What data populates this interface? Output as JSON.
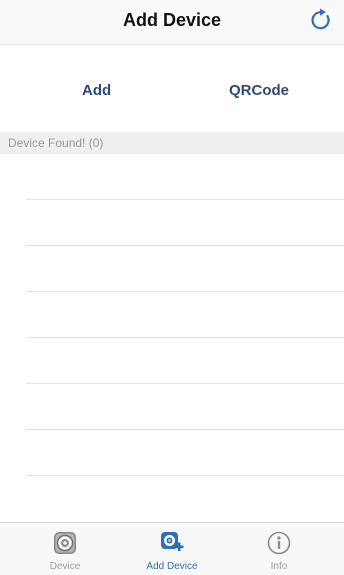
{
  "navbar": {
    "title": "Add Device",
    "refresh_icon": "refresh-icon"
  },
  "actions": {
    "add_label": "Add",
    "qrcode_label": "QRCode"
  },
  "device_list": {
    "header": "Device Found! (0)",
    "rows": [
      "",
      "",
      "",
      "",
      "",
      "",
      "",
      ""
    ]
  },
  "tabbar": {
    "tabs": [
      {
        "label": "Device",
        "icon": "camera-icon",
        "active": false
      },
      {
        "label": "Add Device",
        "icon": "add-camera-icon",
        "active": true
      },
      {
        "label": "Info",
        "icon": "info-icon",
        "active": false
      }
    ]
  },
  "colors": {
    "accent": "#2d6fb8",
    "action_text": "#2f4a75",
    "inactive": "#9b9b9b",
    "section_bg": "#efefef"
  }
}
